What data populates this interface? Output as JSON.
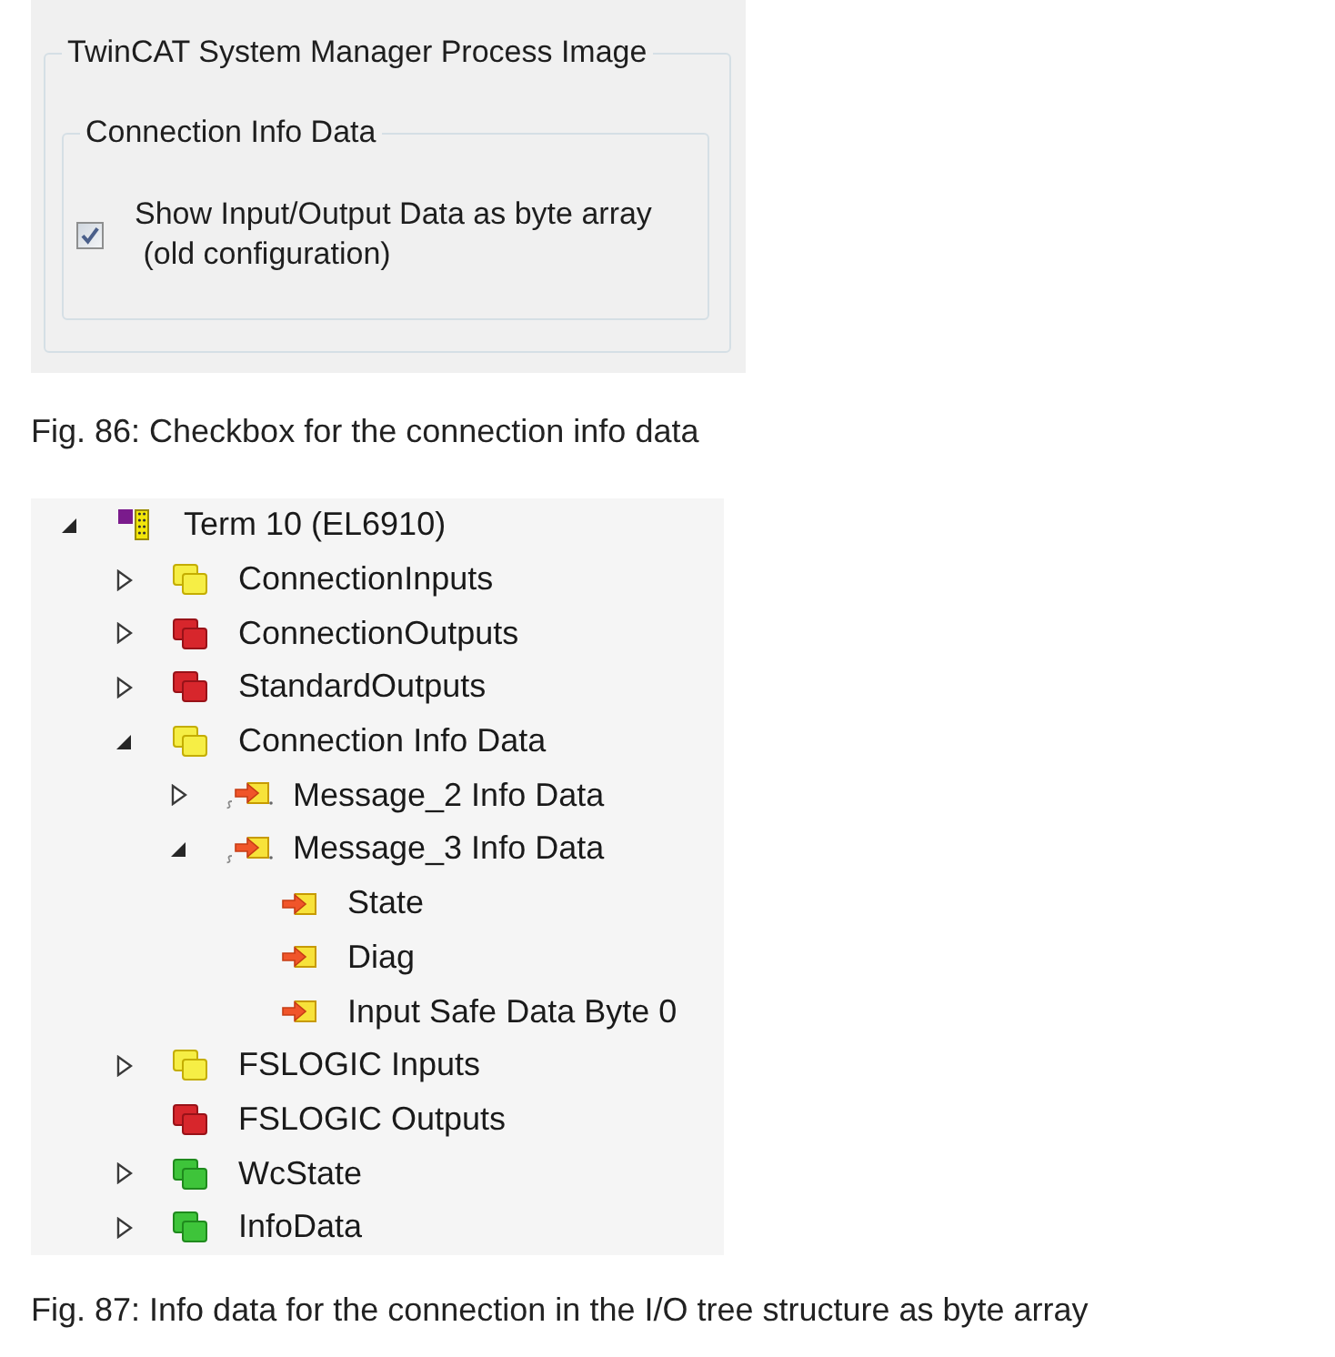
{
  "settings_panel": {
    "group_title": "TwinCAT System Manager Process Image",
    "subgroup": {
      "title": "Connection Info Data",
      "checkbox": {
        "label": "Show Input/Output Data as byte array\n (old configuration)",
        "checked": true
      }
    }
  },
  "settings_caption": "Fig. 86: Checkbox for the connection info data",
  "tree": {
    "items": [
      {
        "label": "Term 10 (EL6910)",
        "kind": "device",
        "expanded": true,
        "children": [
          {
            "label": "ConnectionInputs",
            "kind": "input",
            "expanded": false
          },
          {
            "label": "ConnectionOutputs",
            "kind": "output",
            "expanded": false
          },
          {
            "label": "StandardOutputs",
            "kind": "output",
            "expanded": false
          },
          {
            "label": "Connection Info Data",
            "kind": "input",
            "expanded": true,
            "children": [
              {
                "label": "Message_2 Info Data",
                "kind": "group",
                "expanded": false
              },
              {
                "label": "Message_3 Info Data",
                "kind": "group",
                "expanded": true,
                "children": [
                  {
                    "label": "State",
                    "kind": "variable"
                  },
                  {
                    "label": "Diag",
                    "kind": "variable"
                  },
                  {
                    "label": "Input Safe Data Byte 0",
                    "kind": "variable"
                  }
                ]
              }
            ]
          },
          {
            "label": "FSLOGIC Inputs",
            "kind": "input",
            "expanded": false
          },
          {
            "label": "FSLOGIC Outputs",
            "kind": "output"
          },
          {
            "label": "WcState",
            "kind": "status",
            "expanded": false
          },
          {
            "label": "InfoData",
            "kind": "status",
            "expanded": false
          }
        ]
      }
    ]
  },
  "tree_caption": "Fig. 87: Info data for the connection in the I/O tree structure as byte array"
}
